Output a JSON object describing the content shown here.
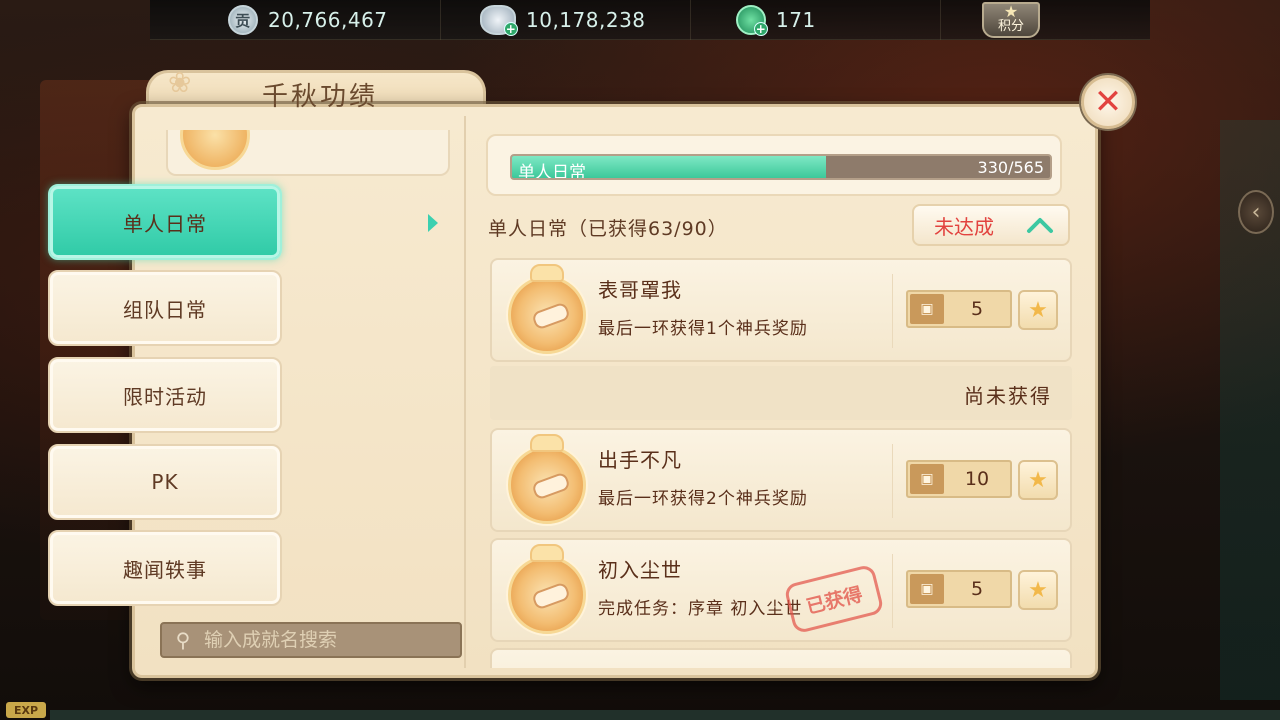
{
  "resources": {
    "contribution": {
      "icon": "coin-icon",
      "glyph": "贡",
      "value": "20,766,467"
    },
    "silver": {
      "icon": "silver-ingot-icon",
      "value": "10,178,238"
    },
    "jade": {
      "icon": "jade-icon",
      "value": "171"
    },
    "points_label": "积分"
  },
  "panel": {
    "title": "千秋功绩",
    "close_icon": "close-icon"
  },
  "categories": [
    {
      "label": "单人日常",
      "active": true
    },
    {
      "label": "组队日常",
      "active": false
    },
    {
      "label": "限时活动",
      "active": false
    },
    {
      "label": "PK",
      "active": false
    },
    {
      "label": "趣闻轶事",
      "active": false
    }
  ],
  "search": {
    "placeholder": "输入成就名搜索"
  },
  "progress": {
    "label": "单人日常",
    "count": "330/565",
    "fraction": 0.584
  },
  "section": {
    "title": "单人日常（已获得63/90）"
  },
  "filter": {
    "label": "未达成"
  },
  "achievements": [
    {
      "name": "表哥罩我",
      "desc": "最后一环获得1个神兵奖励",
      "reward": "5",
      "stamp": ""
    },
    {
      "name": "出手不凡",
      "desc": "最后一环获得2个神兵奖励",
      "reward": "10",
      "stamp": ""
    },
    {
      "name": "初入尘世",
      "desc": "完成任务：序章 初入尘世",
      "reward": "5",
      "stamp": "已获得"
    }
  ],
  "status_divider": "尚未获得",
  "exp_label": "EXP",
  "colors": {
    "accent_teal": "#2fcaa6",
    "close_red": "#e2433f",
    "parchment": "#f7ead0"
  }
}
